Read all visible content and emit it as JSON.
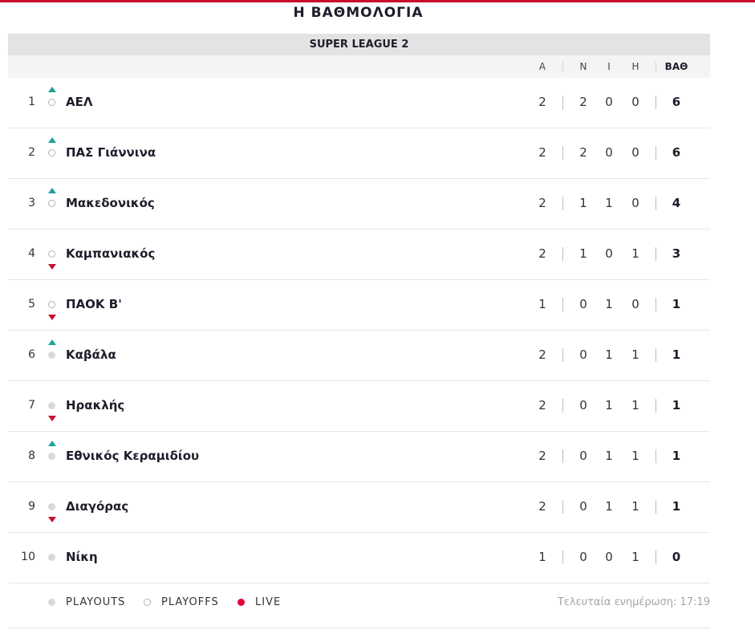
{
  "page": {
    "title": "Η ΒΑΘΜΟΛΟΓΙΑ",
    "league": "SUPER LEAGUE 2",
    "accent_color": "#c8102e"
  },
  "columns": {
    "played": "Α",
    "won": "Ν",
    "draw": "Ι",
    "lost": "Η",
    "points": "ΒΑΘ"
  },
  "standings": [
    {
      "pos": "1",
      "team": "ΑΕΛ",
      "played": "2",
      "won": "2",
      "draw": "0",
      "lost": "0",
      "points": "6",
      "zone": "playoff",
      "trend": "up"
    },
    {
      "pos": "2",
      "team": "ΠΑΣ Γιάννινα",
      "played": "2",
      "won": "2",
      "draw": "0",
      "lost": "0",
      "points": "6",
      "zone": "playoff",
      "trend": "up"
    },
    {
      "pos": "3",
      "team": "Μακεδονικός",
      "played": "2",
      "won": "1",
      "draw": "1",
      "lost": "0",
      "points": "4",
      "zone": "playoff",
      "trend": "up"
    },
    {
      "pos": "4",
      "team": "Καμπανιακός",
      "played": "2",
      "won": "1",
      "draw": "0",
      "lost": "1",
      "points": "3",
      "zone": "playoff",
      "trend": "down"
    },
    {
      "pos": "5",
      "team": "ΠΑΟΚ Β'",
      "played": "1",
      "won": "0",
      "draw": "1",
      "lost": "0",
      "points": "1",
      "zone": "playoff",
      "trend": "down"
    },
    {
      "pos": "6",
      "team": "Καβάλα",
      "played": "2",
      "won": "0",
      "draw": "1",
      "lost": "1",
      "points": "1",
      "zone": "playout",
      "trend": "up"
    },
    {
      "pos": "7",
      "team": "Ηρακλής",
      "played": "2",
      "won": "0",
      "draw": "1",
      "lost": "1",
      "points": "1",
      "zone": "playout",
      "trend": "down"
    },
    {
      "pos": "8",
      "team": "Εθνικός Κεραμιδίου",
      "played": "2",
      "won": "0",
      "draw": "1",
      "lost": "1",
      "points": "1",
      "zone": "playout",
      "trend": "up"
    },
    {
      "pos": "9",
      "team": "Διαγόρας",
      "played": "2",
      "won": "0",
      "draw": "1",
      "lost": "1",
      "points": "1",
      "zone": "playout",
      "trend": "down"
    },
    {
      "pos": "10",
      "team": "Νίκη",
      "played": "1",
      "won": "0",
      "draw": "0",
      "lost": "1",
      "points": "0",
      "zone": "playout",
      "trend": "none"
    }
  ],
  "legend": {
    "playouts": "PLAYOUTS",
    "playoffs": "PLAYOFFS",
    "live": "LIVE",
    "live_color": "#e5003a",
    "updated": "Τελευταία ενημέρωση: 17:19"
  }
}
